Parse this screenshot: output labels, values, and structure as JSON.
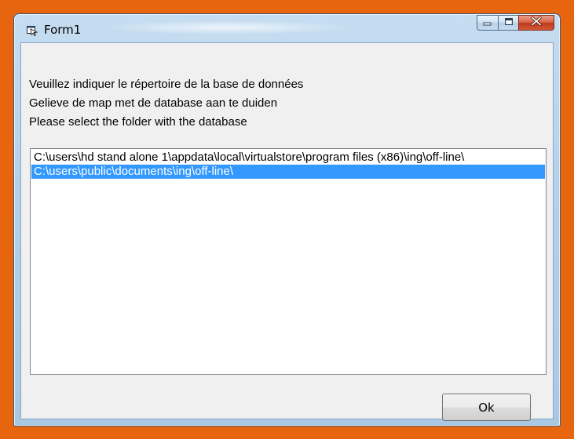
{
  "window": {
    "title": "Form1"
  },
  "instructions": [
    "Veuillez indiquer le répertoire de la base de données",
    "Gelieve de map met de database aan te duiden",
    "Please select the folder with the database"
  ],
  "folder_list": {
    "items": [
      {
        "path": "C:\\users\\hd stand alone 1\\appdata\\local\\virtualstore\\program files (x86)\\ing\\off-line\\",
        "selected": false
      },
      {
        "path": "C:\\users\\public\\documents\\ing\\off-line\\",
        "selected": true
      }
    ]
  },
  "buttons": {
    "ok_label": "Ok"
  },
  "icons": {
    "app": "form-app-icon",
    "minimize": "minimize-icon",
    "maximize": "maximize-icon",
    "close": "close-icon"
  },
  "colors": {
    "frame_background": "#e8650f",
    "selection": "#3399ff",
    "close_button": "#c7462a"
  }
}
